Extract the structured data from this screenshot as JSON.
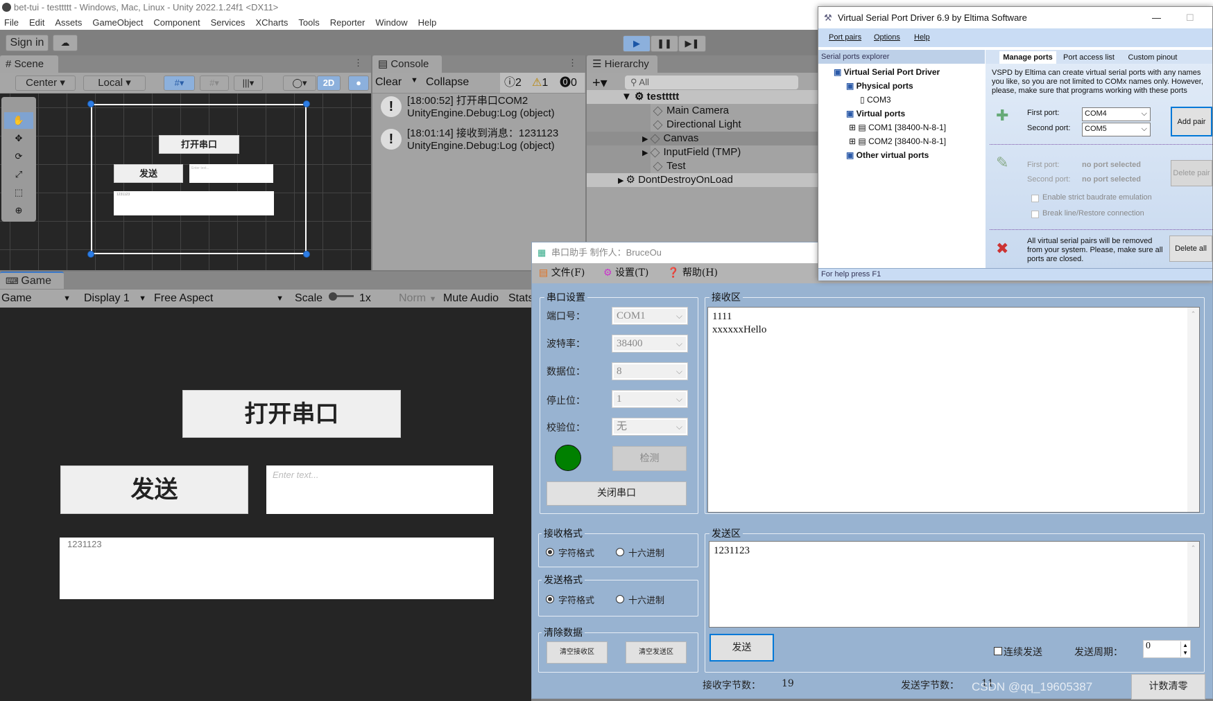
{
  "unity": {
    "title": "bet-tui - testtttt - Windows, Mac, Linux - Unity 2022.1.24f1 <DX11>",
    "menu": [
      "File",
      "Edit",
      "Assets",
      "GameObject",
      "Component",
      "Services",
      "XCharts",
      "Tools",
      "Reporter",
      "Window",
      "Help"
    ],
    "sign_in": "Sign in",
    "scene": {
      "tab": "Scene",
      "center": "Center",
      "local": "Local",
      "mode_2d": "2D"
    },
    "scene_canvas": {
      "open_btn": "打开串口",
      "send_btn": "发送",
      "input_placeholder": "Enter text...",
      "text": "1231123"
    },
    "console": {
      "tab": "Console",
      "clear": "Clear",
      "collapse": "Collapse",
      "info_count": "2",
      "warn_count": "1",
      "error_count": "0",
      "logs": [
        {
          "line1": "[18:00:52] 打开串口COM2",
          "line2": "UnityEngine.Debug:Log (object)"
        },
        {
          "line1": "[18:01:14] 接收到消息：1231123",
          "line2": "UnityEngine.Debug:Log (object)"
        }
      ]
    },
    "hierarchy": {
      "tab": "Hierarchy",
      "search_placeholder": "All",
      "scene": "testtttt",
      "items": [
        "Main Camera",
        "Directional Light",
        "Canvas",
        "InputField (TMP)",
        "Test"
      ],
      "dont_destroy": "DontDestroyOnLoad"
    },
    "game": {
      "tab": "Game",
      "view": "Game",
      "display": "Display 1",
      "aspect": "Free Aspect",
      "scale_label": "Scale",
      "scale_value": "1x",
      "norm": "Norm",
      "mute": "Mute Audio",
      "stats": "Stats",
      "open_btn": "打开串口",
      "send_btn": "发送",
      "input_placeholder": "Enter text...",
      "text": "1231123"
    }
  },
  "vspd": {
    "title": "Virtual Serial Port Driver 6.9 by Eltima Software",
    "menu": [
      "Port pairs",
      "Options",
      "Help"
    ],
    "explorer_header": "Serial ports explorer",
    "tabs": [
      "Manage ports",
      "Port access list",
      "Custom pinout"
    ],
    "tree": {
      "root": "Virtual Serial Port Driver",
      "physical": "Physical ports",
      "com3": "COM3",
      "virtual": "Virtual ports",
      "com1": "COM1 [38400-N-8-1]",
      "com2": "COM2 [38400-N-8-1]",
      "other": "Other virtual ports"
    },
    "description": "VSPD by Eltima can create virtual serial ports with any names you like, so you are not limited to COMx names only. However, please, make sure that programs working with these ports support custom port names.",
    "first_port_label": "First port:",
    "second_port_label": "Second port:",
    "first_port": "COM4",
    "second_port": "COM5",
    "add_pair": "Add pair",
    "no_port": "no port selected",
    "delete_pair": "Delete pair",
    "checkboxes": [
      "Enable strict baudrate emulation",
      "Break line/Restore connection"
    ],
    "delete_all_text": "All virtual serial pairs will be removed from your system. Please, make sure all ports are closed.",
    "delete_all": "Delete all",
    "status": "For help press F1"
  },
  "serial": {
    "title": "串口助手 制作人：BruceOu",
    "menu": [
      "文件(F)",
      "设置(T)",
      "帮助(H)"
    ],
    "port_settings": {
      "legend": "串口设置",
      "fields": [
        {
          "label": "端口号：",
          "value": "COM1"
        },
        {
          "label": "波特率：",
          "value": "38400"
        },
        {
          "label": "数据位：",
          "value": "8"
        },
        {
          "label": "停止位：",
          "value": "1"
        },
        {
          "label": "校验位：",
          "value": "无"
        }
      ],
      "status_color": "#008000",
      "detect": "检测",
      "close_port": "关闭串口"
    },
    "receive": {
      "legend": "接收区",
      "text": "1111\nxxxxxxHello"
    },
    "recv_format": {
      "legend": "接收格式",
      "options": [
        "字符格式",
        "十六进制"
      ],
      "selected": 0
    },
    "send_format": {
      "legend": "发送格式",
      "options": [
        "字符格式",
        "十六进制"
      ],
      "selected": 0
    },
    "clear": {
      "legend": "清除数据",
      "clear_recv": "清空接收区",
      "clear_send": "清空发送区"
    },
    "send": {
      "legend": "发送区",
      "text": "1231123",
      "send_btn": "发送",
      "continuous": "连续发送",
      "period_label": "发送周期：",
      "period_value": "0"
    },
    "footer": {
      "recv_label": "接收字节数：",
      "recv_count": "19",
      "send_label": "发送字节数：",
      "send_count": "11",
      "reset": "计数清零"
    },
    "watermark": "CSDN @qq_19605387"
  }
}
